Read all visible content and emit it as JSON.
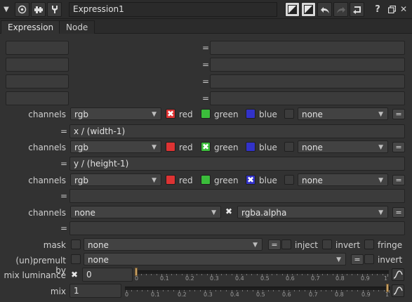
{
  "header": {
    "node_name": "Expression1",
    "icons": [
      "collapse-arrow-icon",
      "circle-dot-icon",
      "tool-icon",
      "wrench-icon",
      "diagonal-a-icon",
      "diagonal-b-icon",
      "undo-icon",
      "redo-icon",
      "revert-icon",
      "help-icon",
      "float-icon",
      "close-icon"
    ],
    "help_label": "?",
    "close_label": "✕"
  },
  "tabs": [
    {
      "label": "Expression",
      "active": true
    },
    {
      "label": "Node",
      "active": false
    }
  ],
  "temp_rows": [
    {
      "name": "",
      "eq": "=",
      "expr": ""
    },
    {
      "name": "",
      "eq": "=",
      "expr": ""
    },
    {
      "name": "",
      "eq": "=",
      "expr": ""
    },
    {
      "name": "",
      "eq": "=",
      "expr": ""
    }
  ],
  "channel_blocks": [
    {
      "label": "channels",
      "layer": "rgb",
      "checks": [
        {
          "name": "red",
          "checked": true,
          "color": "#d33"
        },
        {
          "name": "green",
          "checked": false,
          "color": "#3bbd3b"
        },
        {
          "name": "blue",
          "checked": false,
          "color": "#3232c8"
        }
      ],
      "extra": "none",
      "eq_button": "=",
      "expr_eq": "=",
      "expr": "x / (width-1)"
    },
    {
      "label": "channels",
      "layer": "rgb",
      "checks": [
        {
          "name": "red",
          "checked": false,
          "color": "#d33"
        },
        {
          "name": "green",
          "checked": true,
          "color": "#3bbd3b"
        },
        {
          "name": "blue",
          "checked": false,
          "color": "#3232c8"
        }
      ],
      "extra": "none",
      "eq_button": "=",
      "expr_eq": "=",
      "expr": "y / (height-1)"
    },
    {
      "label": "channels",
      "layer": "rgb",
      "checks": [
        {
          "name": "red",
          "checked": false,
          "color": "#d33"
        },
        {
          "name": "green",
          "checked": false,
          "color": "#3bbd3b"
        },
        {
          "name": "blue",
          "checked": true,
          "color": "#3232c8"
        }
      ],
      "extra": "none",
      "eq_button": "=",
      "expr_eq": "=",
      "expr": ""
    }
  ],
  "alpha_block": {
    "label": "channels",
    "layer": "none",
    "check_label": "✖",
    "channel": "rgba.alpha",
    "eq_button": "=",
    "expr_eq": "=",
    "expr": ""
  },
  "mask": {
    "label": "mask",
    "value": "none",
    "eq_button": "=",
    "inject_label": "inject",
    "invert_label": "invert",
    "fringe_label": "fringe"
  },
  "premult": {
    "label": "(un)premult by",
    "value": "none",
    "eq_button": "=",
    "invert_label": "invert"
  },
  "mix_luminance": {
    "label": "mix luminance",
    "value": "0",
    "fraction": 0.0,
    "check_label": "✖"
  },
  "mix": {
    "label": "mix",
    "value": "1",
    "fraction": 1.0
  },
  "slider_ticks": [
    "0",
    "0.1",
    "0.2",
    "0.3",
    "0.4",
    "0.5",
    "0.6",
    "0.7",
    "0.8",
    "0.9",
    "1"
  ]
}
